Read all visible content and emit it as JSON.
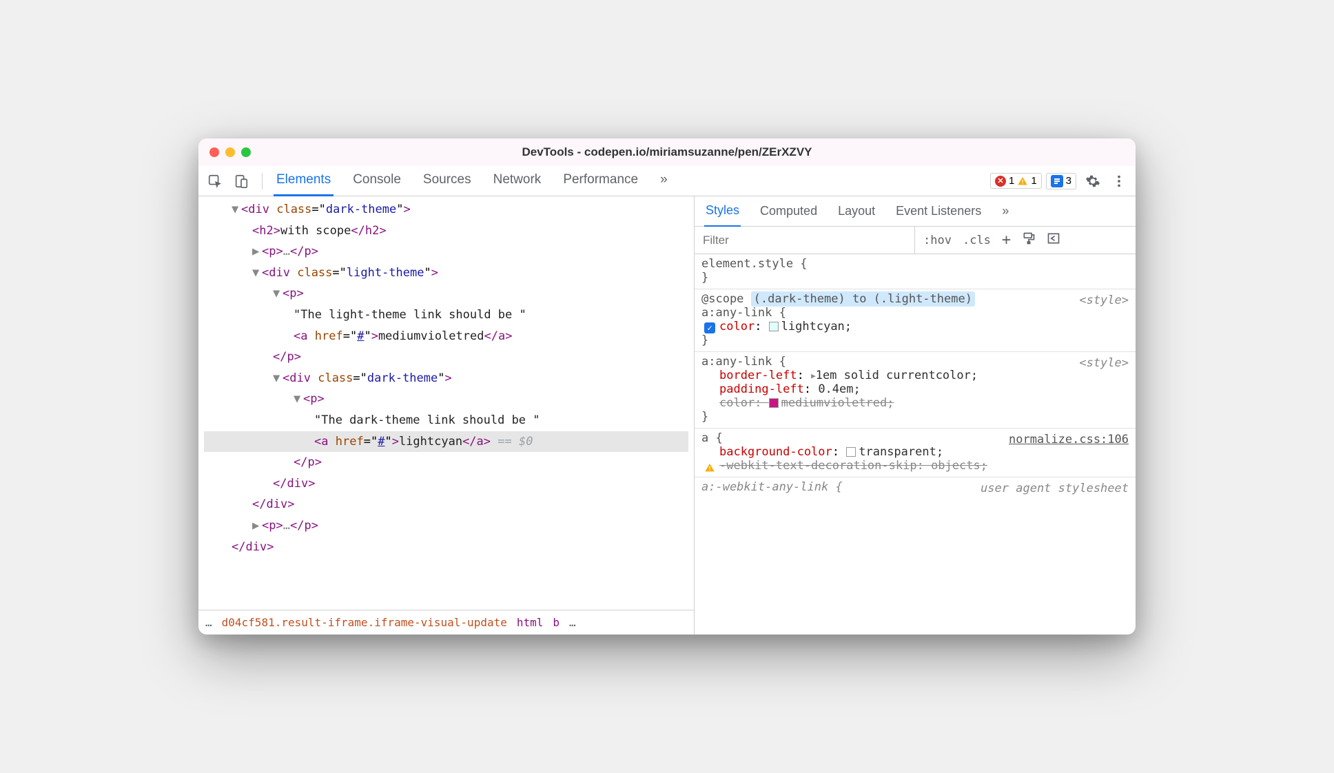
{
  "title": "DevTools - codepen.io/miriamsuzanne/pen/ZErXZVY",
  "tabs": [
    "Elements",
    "Console",
    "Sources",
    "Network",
    "Performance"
  ],
  "badges": {
    "errors": "1",
    "warnings": "1",
    "issues": "3"
  },
  "dom": {
    "divClass1": "dark-theme",
    "h2": "with scope",
    "divClass2": "light-theme",
    "text1": "\"The light-theme link should be \"",
    "href": "#",
    "linkText1": "mediumvioletred",
    "divClass3": "dark-theme",
    "text2": "\"The dark-theme link should be \"",
    "linkText2": "lightcyan",
    "eq0": "== $0"
  },
  "breadcrumb": {
    "ellipsis": "…",
    "item1": "d04cf581.result-iframe.iframe-visual-update",
    "item2": "html",
    "item3": "b"
  },
  "subtabs": [
    "Styles",
    "Computed",
    "Layout",
    "Event Listeners"
  ],
  "filter": {
    "placeholder": "Filter",
    "hov": ":hov",
    "cls": ".cls"
  },
  "styles": {
    "elementStyle": {
      "selector": "element.style {",
      "close": "}"
    },
    "rule1": {
      "scopePrefix": "@scope",
      "scope": "(.dark-theme) to (.light-theme)",
      "selector": "a:any-link {",
      "src": "<style>",
      "propName": "color",
      "propVal": "lightcyan;",
      "swatchColor": "#e0ffff",
      "close": "}"
    },
    "rule2": {
      "selector": "a:any-link {",
      "src": "<style>",
      "prop1Name": "border-left",
      "prop1Val": "1em solid currentcolor;",
      "prop2Name": "padding-left",
      "prop2Val": "0.4em;",
      "prop3Name": "color",
      "prop3Val": "mediumvioletred;",
      "swatchColor": "#c71585",
      "close": "}"
    },
    "rule3": {
      "selector": "a {",
      "src": "normalize.css:106",
      "prop1Name": "background-color",
      "prop1Val": "transparent;",
      "swatchColor": "#ffffff",
      "prop2Name": "-webkit-text-decoration-skip",
      "prop2Val": "objects;"
    },
    "rule4": {
      "selector": "a:-webkit-any-link {",
      "src": "user agent stylesheet"
    }
  }
}
